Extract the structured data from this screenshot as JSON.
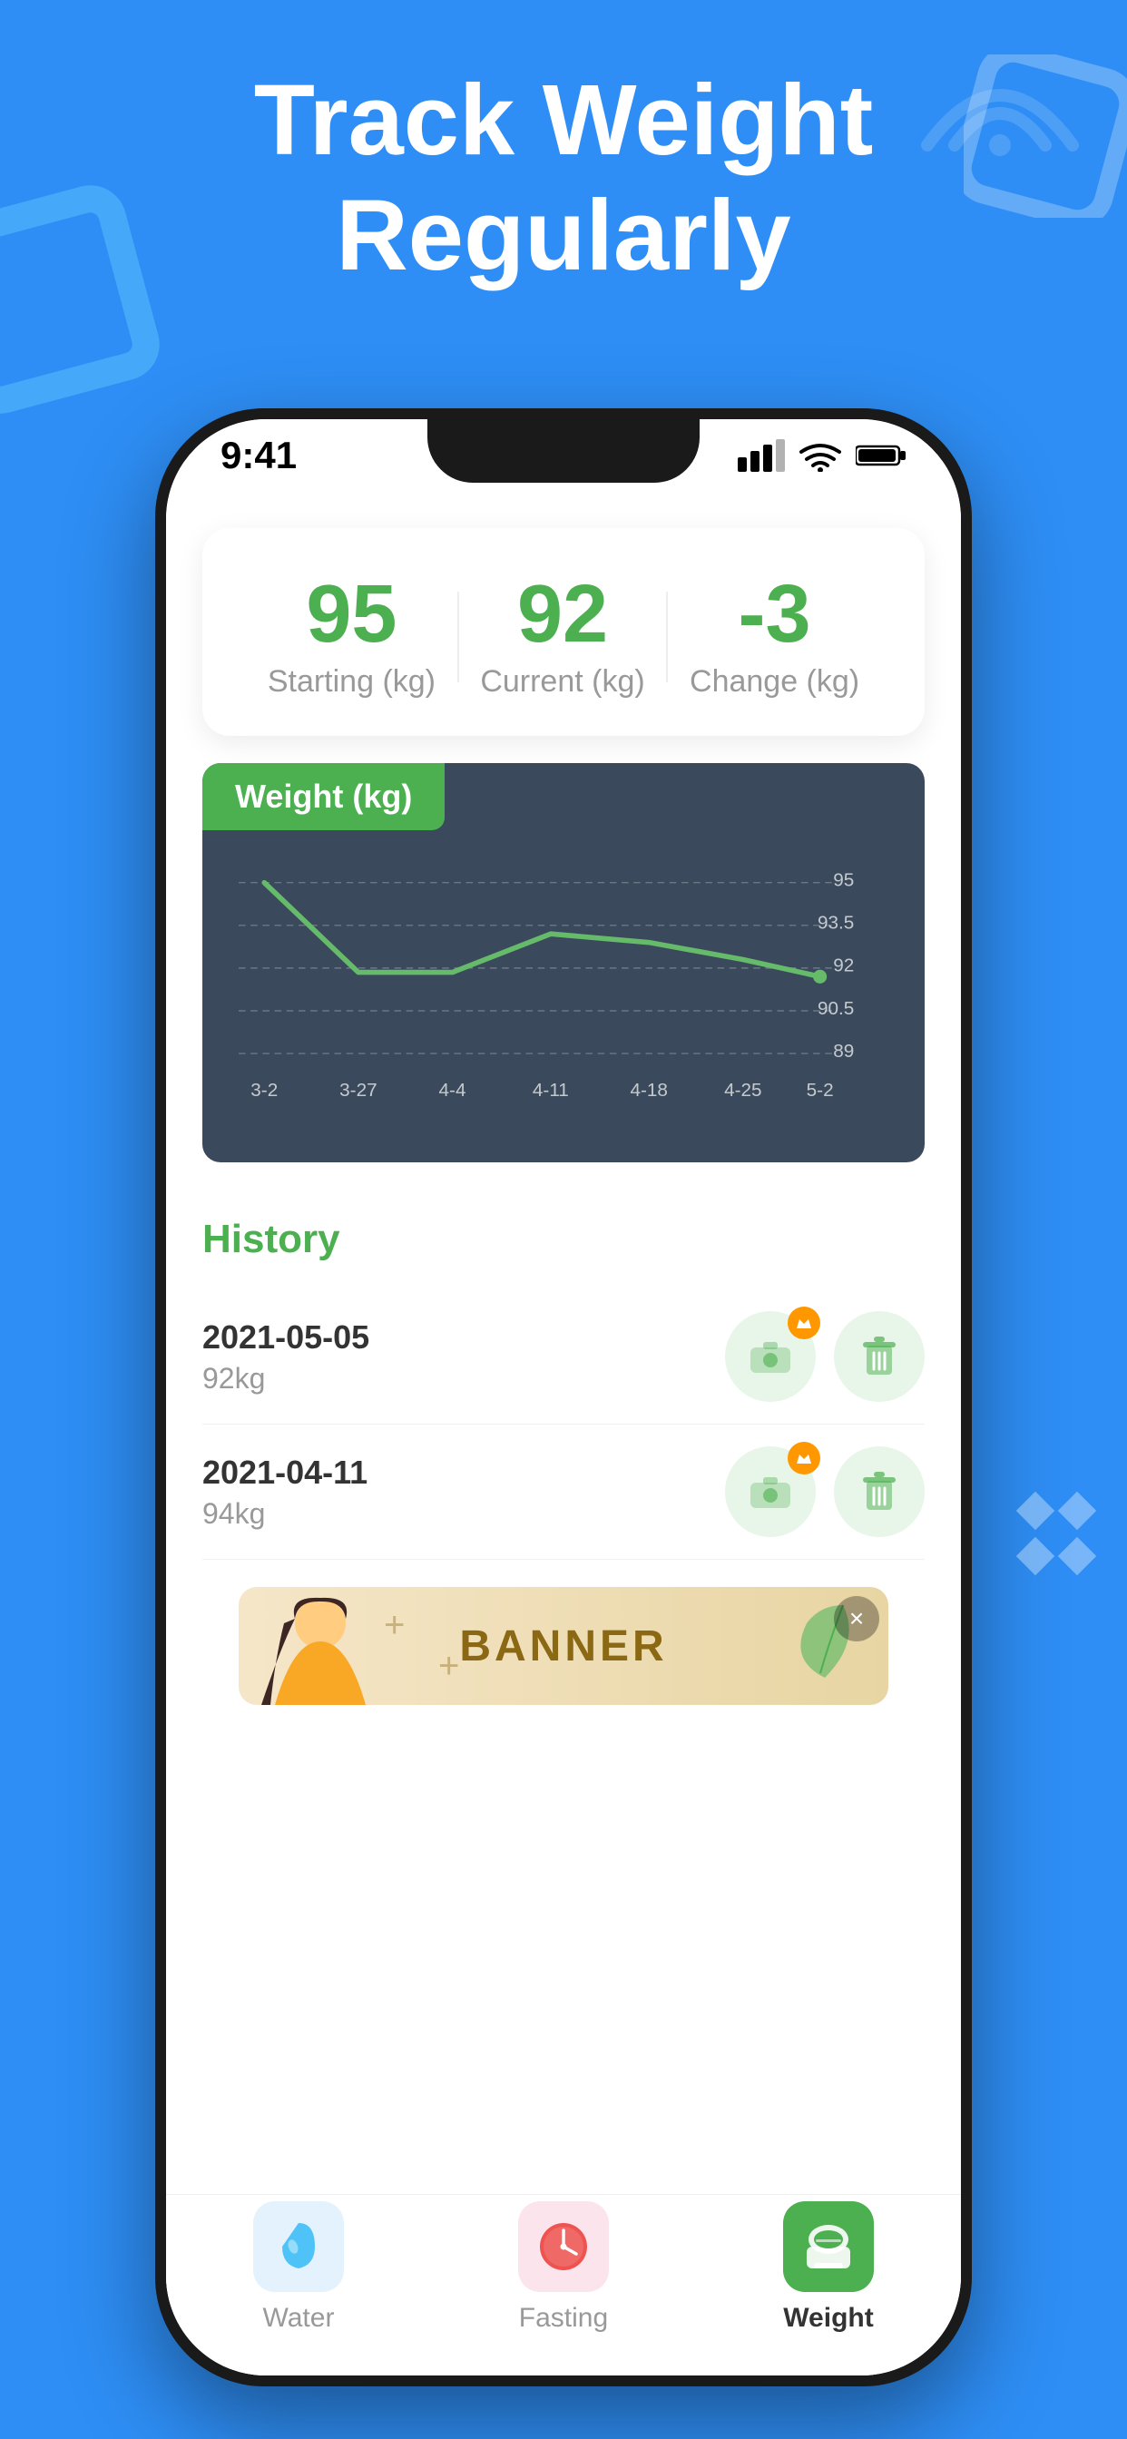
{
  "hero": {
    "title_line1": "Track Weight",
    "title_line2": "Regularly"
  },
  "status_bar": {
    "time": "9:41"
  },
  "stats": {
    "starting_value": "95",
    "starting_label": "Starting (kg)",
    "current_value": "92",
    "current_label": "Current (kg)",
    "change_value": "-3",
    "change_label": "Change (kg)"
  },
  "chart": {
    "title": "Weight",
    "unit": "(kg)",
    "y_labels": [
      "95",
      "93.5",
      "92",
      "90.5",
      "89"
    ],
    "x_labels": [
      "3-2",
      "3-27",
      "4-4",
      "4-11",
      "4-18",
      "4-25",
      "5-2"
    ]
  },
  "history": {
    "title": "History",
    "items": [
      {
        "date": "2021-05-05",
        "weight": "92kg"
      },
      {
        "date": "2021-04-11",
        "weight": "94kg"
      }
    ]
  },
  "banner": {
    "text": "BANNER",
    "close_label": "×"
  },
  "tabs": [
    {
      "label": "Water",
      "icon": "💧",
      "active": false,
      "icon_style": "water"
    },
    {
      "label": "Fasting",
      "icon": "⏰",
      "active": false,
      "icon_style": "fasting"
    },
    {
      "label": "Weight",
      "icon": "⚖️",
      "active": true,
      "icon_style": "weight"
    }
  ]
}
